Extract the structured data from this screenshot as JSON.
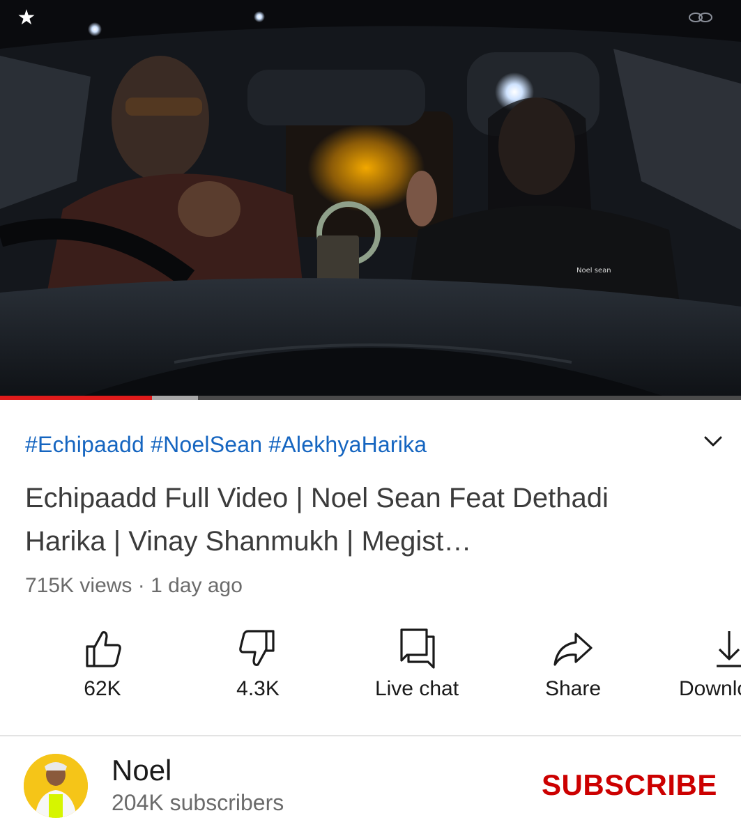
{
  "video": {
    "watermark": "Noel sean",
    "progress_played": 0.205,
    "progress_buffered": 0.267
  },
  "info": {
    "hashtags": "#Echipaadd #NoelSean #AlekhyaHarika",
    "title": "Echipaadd Full Video | Noel Sean Feat Dethadi Harika | Vinay Shanmukh | Megist…",
    "views": "715K views",
    "separator": "·",
    "age": "1 day ago"
  },
  "actions": {
    "like": {
      "label": "62K",
      "icon": "thumbs-up-icon"
    },
    "dislike": {
      "label": "4.3K",
      "icon": "thumbs-down-icon"
    },
    "live_chat": {
      "label": "Live chat",
      "icon": "chat-icon"
    },
    "share": {
      "label": "Share",
      "icon": "share-icon"
    },
    "download": {
      "label": "Download",
      "icon": "download-icon"
    }
  },
  "channel": {
    "name": "Noel",
    "subscribers": "204K subscribers",
    "subscribe_label": "SUBSCRIBE"
  },
  "colors": {
    "accent_red": "#cc0000",
    "hashtag_blue": "#1565c0",
    "progress_red": "#e01b1b"
  }
}
